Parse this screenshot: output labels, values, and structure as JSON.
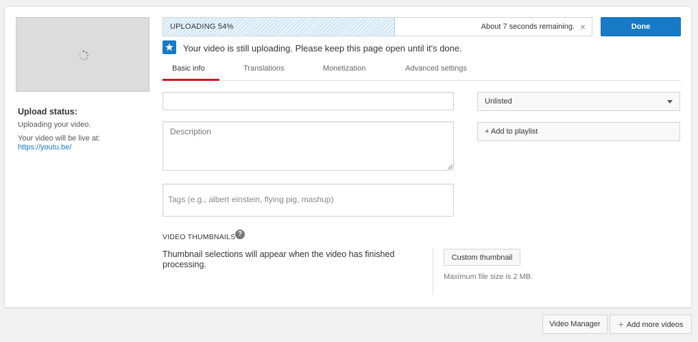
{
  "upload": {
    "progress_label": "UPLOADING 54%",
    "progress_fraction": 0.54,
    "remaining": "About 7 seconds remaining.",
    "close_glyph": "×",
    "done_label": "Done",
    "notice": "Your video is still uploading. Please keep this page open until it's done."
  },
  "status": {
    "title": "Upload status:",
    "text": "Uploading your video.",
    "live_text": "Your video will be live at:",
    "link": "https://youtu.be/"
  },
  "tabs": [
    {
      "label": "Basic info",
      "active": true
    },
    {
      "label": "Translations",
      "active": false
    },
    {
      "label": "Monetization",
      "active": false
    },
    {
      "label": "Advanced settings",
      "active": false
    }
  ],
  "form": {
    "title_value": "",
    "description_placeholder": "Description",
    "tags_placeholder": "Tags (e.g., albert einstein, flying pig, mashup)",
    "privacy_value": "Unlisted",
    "add_playlist_label": "+ Add to playlist"
  },
  "thumbnails": {
    "heading": "VIDEO THUMBNAILS",
    "help_glyph": "?",
    "message": "Thumbnail selections will appear when the video has finished processing.",
    "custom_button": "Custom thumbnail",
    "max_size": "Maximum file size is 2 MB."
  },
  "footer": {
    "video_manager": "Video Manager",
    "add_more_plus": "+",
    "add_more": "Add more videos"
  },
  "colors": {
    "accent": "#167ac6",
    "tab_active": "#cc181e"
  },
  "icons": {
    "spinner": "loading-spinner-icon",
    "star": "star-icon",
    "caret": "caret-down-icon",
    "help": "help-icon",
    "close": "close-icon",
    "plus": "plus-icon"
  }
}
